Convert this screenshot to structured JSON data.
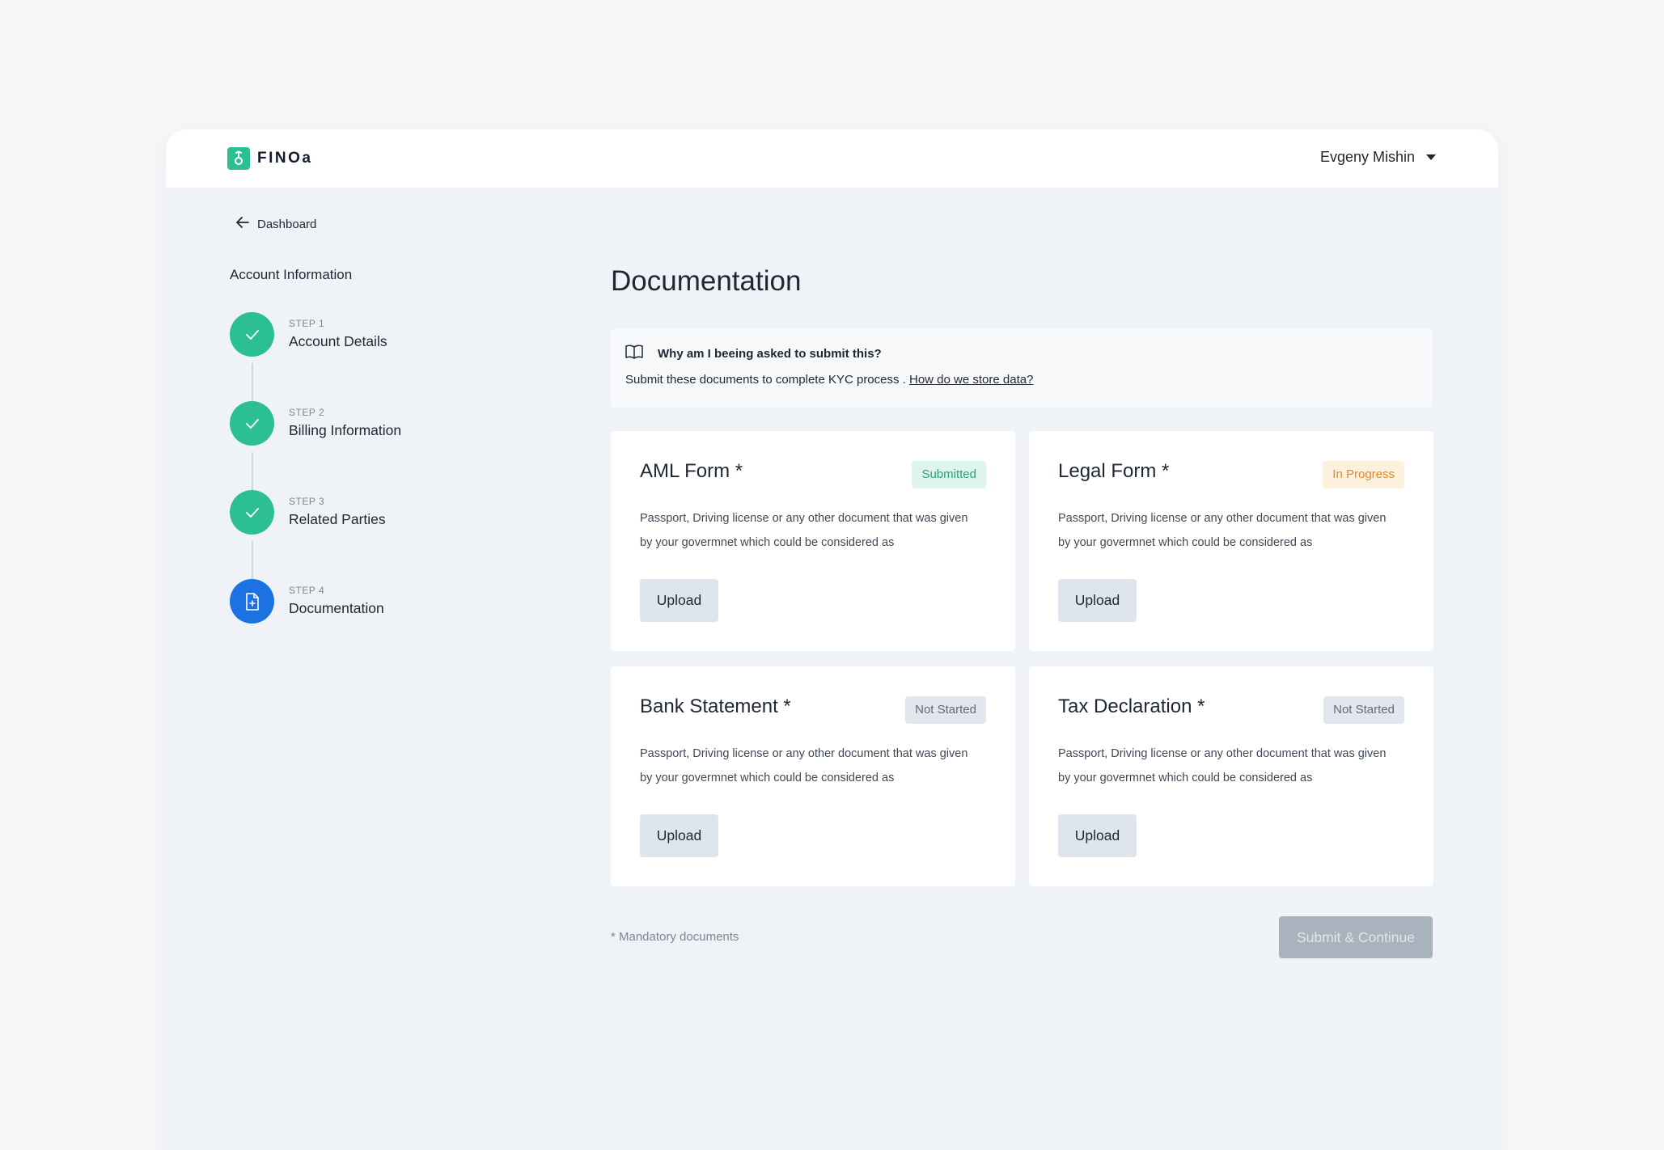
{
  "header": {
    "brand": "FINOa",
    "user_name": "Evgeny Mishin",
    "icons": {
      "logo": "finoa-logo-icon",
      "caret": "caret-down-icon"
    }
  },
  "sidebar": {
    "back_label": "Dashboard",
    "heading": "Account Information",
    "steps": [
      {
        "kicker": "STEP 1",
        "title": "Account Details",
        "state": "done"
      },
      {
        "kicker": "STEP 2",
        "title": "Billing Information",
        "state": "done"
      },
      {
        "kicker": "STEP 3",
        "title": "Related Parties",
        "state": "done"
      },
      {
        "kicker": "STEP 4",
        "title": "Documentation",
        "state": "current"
      }
    ]
  },
  "main": {
    "title": "Documentation",
    "info": {
      "question": "Why am I beeing asked to submit this?",
      "body": "Submit these documents to complete KYC process . ",
      "link": "How do we store data?"
    },
    "cards": [
      {
        "title": "AML Form *",
        "status": "Submitted",
        "desc": "Passport, Driving license or any other document that was given by your govermnet which could be considered as",
        "button": "Upload"
      },
      {
        "title": "Legal Form *",
        "status": "In Progress",
        "desc": "Passport, Driving license or any other document that was given by your govermnet which could be considered as",
        "button": "Upload"
      },
      {
        "title": "Bank Statement *",
        "status": "Not Started",
        "desc": "Passport, Driving license or any other document that was given by your govermnet which could be considered as",
        "button": "Upload"
      },
      {
        "title": "Tax Declaration *",
        "status": "Not Started",
        "desc": "Passport, Driving license or any other document that was given by your govermnet which could be considered as",
        "button": "Upload"
      }
    ],
    "footnote": "* Mandatory documents",
    "submit_label": "Submit & Continue"
  },
  "colors": {
    "accent_green": "#2dbf94",
    "accent_blue": "#1b72e0",
    "badge_submitted": "#23a57e",
    "badge_in_progress": "#e08a2f",
    "badge_not_started": "#5f6b78"
  }
}
